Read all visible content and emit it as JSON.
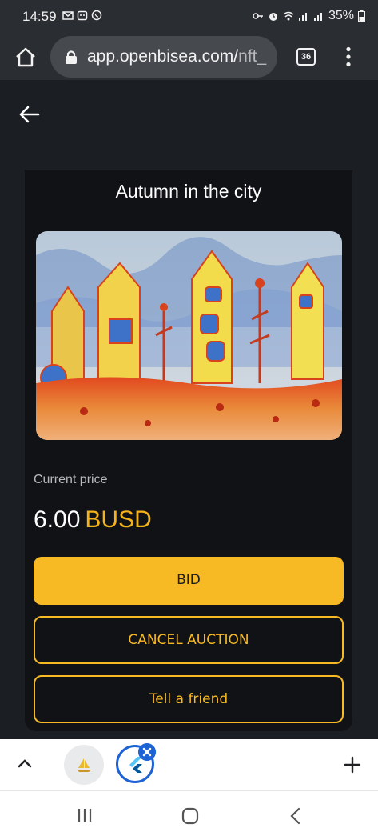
{
  "status_bar": {
    "time": "14:59",
    "battery": "35%"
  },
  "browser": {
    "url_main": "app.openbisea.com/",
    "url_rest": "nft_",
    "tab_count": "36"
  },
  "nft": {
    "title": "Autumn in the city"
  },
  "auction": {
    "price_label": "Current price",
    "price_value": "6.00",
    "price_currency": "BUSD",
    "bid_label": "BID",
    "cancel_label": "CANCEL AUCTION",
    "tell_label": "Tell a friend"
  },
  "colors": {
    "accent": "#f7b924",
    "background": "#1b1e23",
    "card": "#101215",
    "tab_highlight": "#1e63d6"
  }
}
